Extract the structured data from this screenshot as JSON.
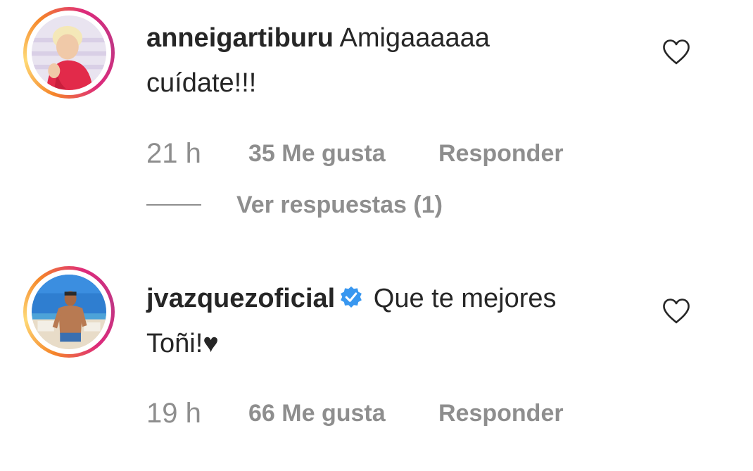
{
  "comments": [
    {
      "username": "anneigartiburu",
      "text_line1": " Amigaaaaaa",
      "text_line2": "cuídate!!!",
      "verified": false,
      "time": "21 h",
      "likes": "35 Me gusta",
      "reply_label": "Responder",
      "view_replies": "Ver respuestas (1)",
      "avatar_icon": "avatar-woman-pink-shirt"
    },
    {
      "username": "jvazquezoficial",
      "text_line1": " Que te mejores",
      "text_line2": "Toñi!",
      "emoji": "♥",
      "verified": true,
      "time": "19 h",
      "likes": "66 Me gusta",
      "reply_label": "Responder",
      "avatar_icon": "avatar-man-beach"
    }
  ],
  "colors": {
    "text": "#262626",
    "meta": "#8e8e8e",
    "verified": "#3897f0"
  },
  "icons": {
    "like": "heart-outline-icon",
    "verified": "verified-badge-icon"
  }
}
